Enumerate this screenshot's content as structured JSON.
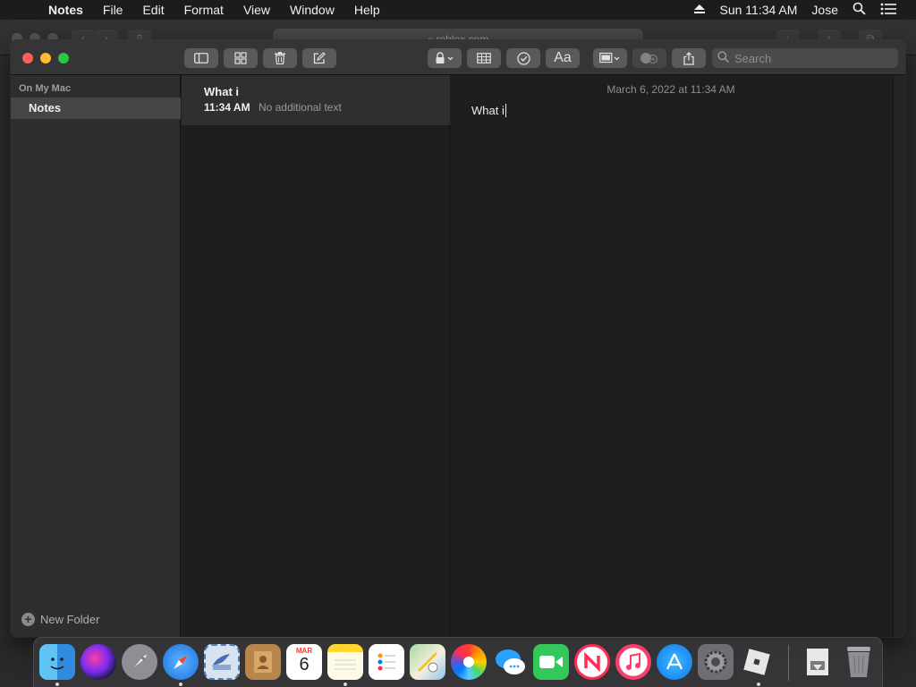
{
  "menubar": {
    "apple_glyph": "",
    "app_name": "Notes",
    "items": [
      "File",
      "Edit",
      "Format",
      "View",
      "Window",
      "Help"
    ],
    "clock": "Sun 11:34 AM",
    "user": "Jose"
  },
  "background_window": {
    "url": "roblox.com"
  },
  "toolbar": {
    "format_label": "Aa",
    "search_placeholder": "Search"
  },
  "sidebar": {
    "section_header": "On My Mac",
    "folder": "Notes",
    "new_folder_label": "New Folder"
  },
  "note_list": [
    {
      "title": "What i",
      "time": "11:34 AM",
      "preview": "No additional text"
    }
  ],
  "editor": {
    "date": "March 6, 2022 at 11:34 AM",
    "text": "What i"
  },
  "dock": {
    "calendar_month": "MAR",
    "calendar_day": "6",
    "apps": [
      "finder-icon",
      "siri-icon",
      "launchpad-icon",
      "safari-icon",
      "mail-icon",
      "contacts-icon",
      "calendar-icon",
      "notes-icon",
      "reminders-icon",
      "maps-icon",
      "photos-icon",
      "messages-icon",
      "facetime-icon",
      "news-icon",
      "music-icon",
      "app-store-icon",
      "system-preferences-icon",
      "roblox-icon",
      "downloads-icon",
      "trash-icon"
    ]
  },
  "colors": {
    "close": "#fe5f57",
    "minimize": "#febc2e",
    "maximize": "#28c840",
    "selection": "#464648"
  }
}
